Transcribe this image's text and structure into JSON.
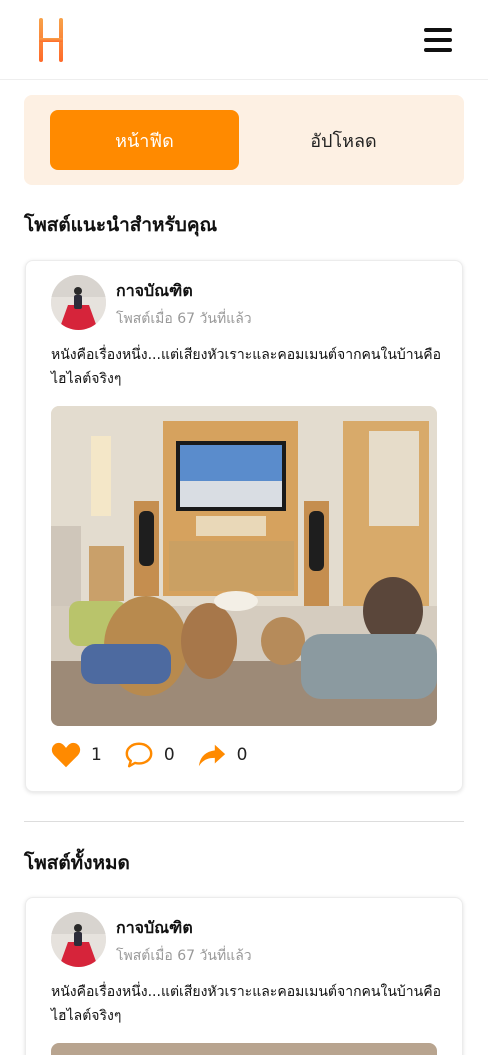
{
  "theme": {
    "accent": "#ff8a00",
    "tab_bg": "#fdf0e3",
    "muted_text": "#999999"
  },
  "header": {
    "logo_icon": "brand-logo-h",
    "menu_icon": "hamburger-menu-icon"
  },
  "tabs": [
    {
      "label": "หน้าฟีด",
      "active": true
    },
    {
      "label": "อัปโหลด",
      "active": false
    }
  ],
  "sections": {
    "recommended_title": "โพสต์แนะนำสำหรับคุณ",
    "all_title": "โพสต์ทั้งหมด"
  },
  "recommended_post": {
    "author": "กาจบัณฑิต",
    "posted": "โพสต์เมื่อ 67 วันที่แล้ว",
    "text": "หนังคือเรื่องหนึ่ง...แต่เสียงหัวเราะและคอมเมนต์จากคนในบ้านคือไฮไลต์จริงๆ",
    "likes": "1",
    "comments": "0",
    "shares": "0"
  },
  "all_posts": [
    {
      "author": "กาจบัณฑิต",
      "posted": "โพสต์เมื่อ 67 วันที่แล้ว",
      "text": "หนังคือเรื่องหนึ่ง...แต่เสียงหัวเราะและคอมเมนต์จากคนในบ้านคือไฮไลต์จริงๆ"
    }
  ]
}
